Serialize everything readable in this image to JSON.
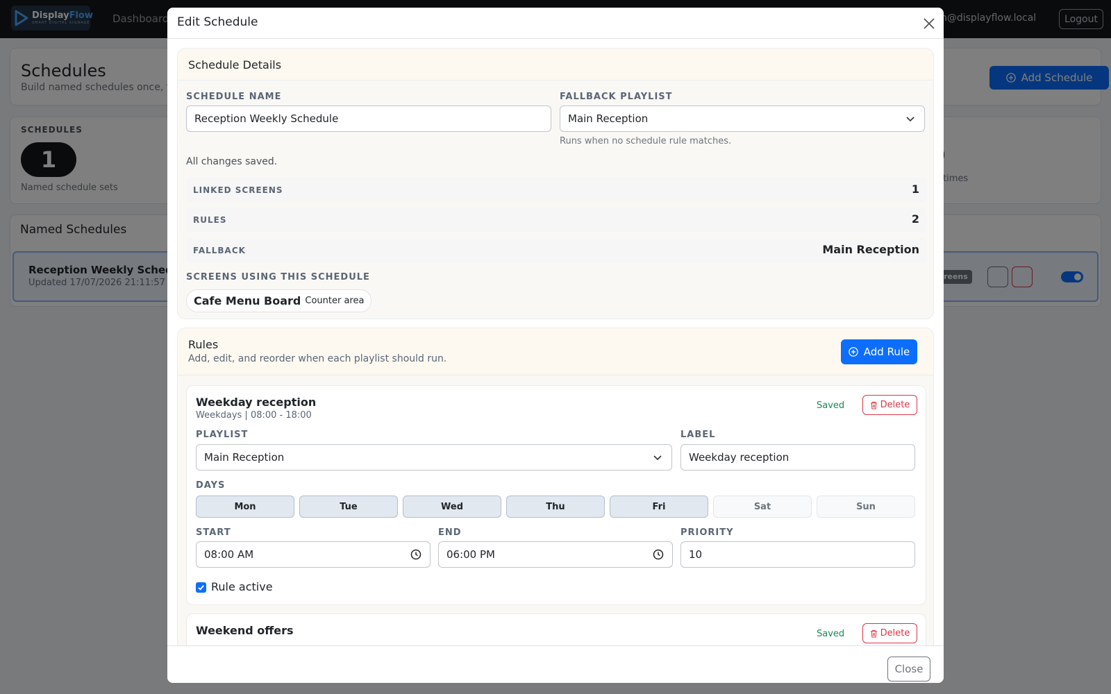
{
  "app": {
    "brand_name_a": "Display",
    "brand_name_b": "Flow",
    "brand_tagline": "SMART DIGITAL SIGNAGE",
    "nav_link": "Dashboard",
    "user_email": "admin@displayflow.local",
    "logout_label": "Logout"
  },
  "page": {
    "title": "Schedules",
    "subtitle": "Build named schedules once, th",
    "add_schedule_label": "Add Schedule",
    "stats_label": "SCHEDULES",
    "stats_value": "1",
    "stats_sub": "Named schedule sets",
    "stats_right_sub": "times",
    "named_title": "Named Schedules",
    "row_name": "Reception Weekly Schedu",
    "row_updated": "Updated 17/07/2026 21:11:57",
    "row_badge": "screens"
  },
  "modal": {
    "title": "Edit Schedule",
    "close_label": "Close",
    "details": {
      "title": "Schedule Details",
      "name_label": "SCHEDULE NAME",
      "name_value": "Reception Weekly Schedule",
      "fallback_label": "FALLBACK PLAYLIST",
      "fallback_value": "Main Reception",
      "fallback_help": "Runs when no schedule rule matches.",
      "save_status": "All changes saved.",
      "stats": [
        {
          "key": "LINKED SCREENS",
          "value": "1"
        },
        {
          "key": "RULES",
          "value": "2"
        },
        {
          "key": "FALLBACK",
          "value": "Main Reception"
        }
      ],
      "screens_label": "SCREENS USING THIS SCHEDULE",
      "screen_name": "Cafe Menu Board",
      "screen_location": "Counter area"
    },
    "rules": {
      "title": "Rules",
      "subtitle": "Add, edit, and reorder when each playlist should run.",
      "add_label": "Add Rule",
      "items": [
        {
          "title": "Weekday reception",
          "summary": "Weekdays | 08:00 - 18:00",
          "saved": "Saved",
          "delete_label": "Delete",
          "playlist_label": "PLAYLIST",
          "playlist_value": "Main Reception",
          "label_label": "LABEL",
          "label_value": "Weekday reception",
          "days_label": "DAYS",
          "days": [
            {
              "name": "Mon",
              "active": true
            },
            {
              "name": "Tue",
              "active": true
            },
            {
              "name": "Wed",
              "active": true
            },
            {
              "name": "Thu",
              "active": true
            },
            {
              "name": "Fri",
              "active": true
            },
            {
              "name": "Sat",
              "active": false
            },
            {
              "name": "Sun",
              "active": false
            }
          ],
          "start_label": "START",
          "start_value": "08:00 AM",
          "end_label": "END",
          "end_value": "06:00 PM",
          "priority_label": "PRIORITY",
          "priority_value": "10",
          "active_label": "Rule active"
        },
        {
          "title": "Weekend offers",
          "saved": "Saved",
          "delete_label": "Delete"
        }
      ]
    }
  },
  "colors": {
    "primary": "#0d6efd",
    "danger": "#dc3545",
    "success": "#198754"
  }
}
